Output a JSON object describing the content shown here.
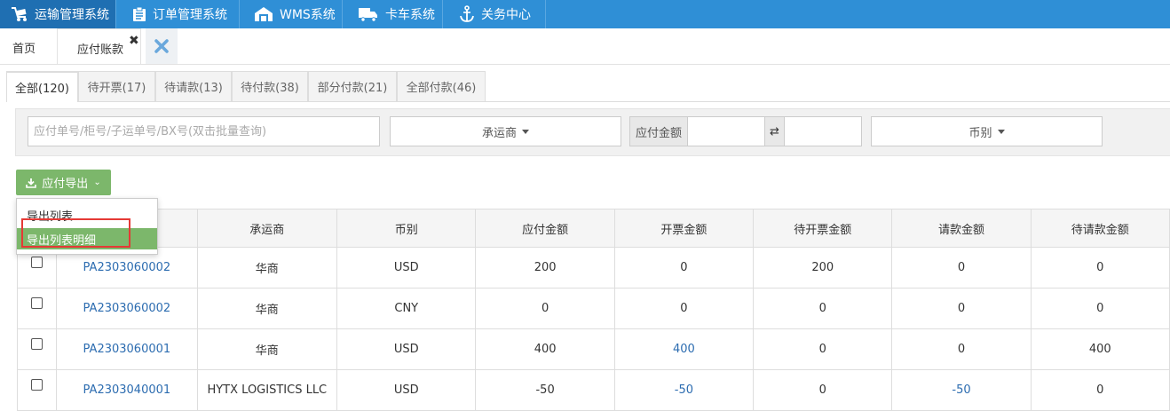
{
  "topnav": {
    "items": [
      {
        "label": "运输管理系统",
        "icon": "truck-cart-icon"
      },
      {
        "label": "订单管理系统",
        "icon": "clipboard-icon"
      },
      {
        "label": "WMS系统",
        "icon": "warehouse-icon"
      },
      {
        "label": "卡车系统",
        "icon": "truck-icon"
      },
      {
        "label": "关务中心",
        "icon": "anchor-icon"
      }
    ]
  },
  "tabbar": {
    "home": "首页",
    "active_tab": "应付账款",
    "close_glyph": "✖"
  },
  "status_tabs": [
    "全部(120)",
    "待开票(17)",
    "待请款(13)",
    "待付款(38)",
    "部分付款(21)",
    "全部付款(46)"
  ],
  "filter": {
    "search_placeholder": "应付单号/柜号/子运单号/BX号(双击批量查询)",
    "carrier_label": "承运商",
    "amount_label": "应付金额",
    "swap_glyph": "⇄",
    "currency_label": "币别"
  },
  "export": {
    "button_label": "应付导出",
    "menu": [
      "导出列表",
      "导出列表明细"
    ]
  },
  "table": {
    "columns": [
      "",
      "承运商",
      "币别",
      "应付金额",
      "开票金额",
      "待开票金额",
      "请款金额",
      "待请款金额"
    ],
    "rows": [
      {
        "id": "PA2303060002",
        "carrier": "华商",
        "currency": "USD",
        "payable": "200",
        "invoiced": "0",
        "to_invoice": "200",
        "requested": "0",
        "to_request": "0"
      },
      {
        "id": "PA2303060002",
        "carrier": "华商",
        "currency": "CNY",
        "payable": "0",
        "invoiced": "0",
        "to_invoice": "0",
        "requested": "0",
        "to_request": "0"
      },
      {
        "id": "PA2303060001",
        "carrier": "华商",
        "currency": "USD",
        "payable": "400",
        "invoiced": "400",
        "to_invoice": "0",
        "requested": "0",
        "to_request": "400"
      },
      {
        "id": "PA2303040001",
        "carrier": "HYTX LOGISTICS LLC",
        "currency": "USD",
        "payable": "-50",
        "invoiced": "-50",
        "to_invoice": "0",
        "requested": "-50",
        "to_request": "0"
      }
    ]
  },
  "colors": {
    "nav": "#2f8fd6",
    "nav_active": "#1f6fb2",
    "export_green": "#7cb76b",
    "link_blue": "#2c6cb0",
    "highlight_red": "#e53935"
  }
}
